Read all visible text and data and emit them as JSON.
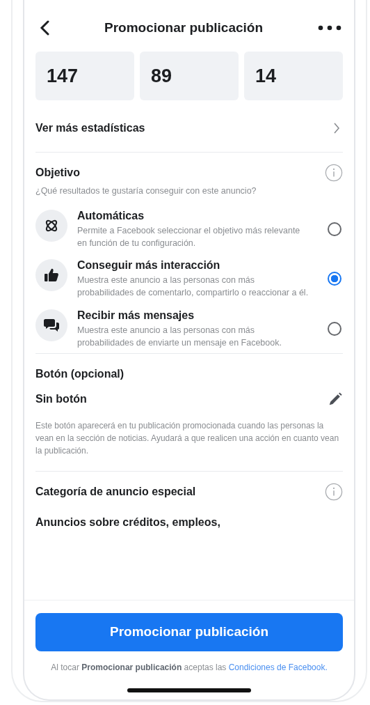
{
  "header": {
    "title": "Promocionar publicación"
  },
  "stats": [
    "147",
    "89",
    "14"
  ],
  "more_stats": {
    "label": "Ver más estadísticas"
  },
  "objective": {
    "title": "Objetivo",
    "question": "¿Qué resultados te gustaría conseguir con este anuncio?",
    "options": [
      {
        "kind": "auto",
        "title": "Automáticas",
        "description": "Permite a Facebook seleccionar el objetivo más relevante en función de tu configuración.",
        "selected": false
      },
      {
        "kind": "like",
        "title": "Conseguir más interacción",
        "description": "Muestra este anuncio a las personas con más probabilidades de comentarlo, compartirlo o reaccionar a él.",
        "selected": true
      },
      {
        "kind": "chat",
        "title": "Recibir más mensajes",
        "description": "Muestra este anuncio a las personas con más probabilidades de enviarte un mensaje en Facebook.",
        "selected": false
      }
    ]
  },
  "button_section": {
    "title": "Botón (opcional)",
    "value": "Sin botón",
    "description": "Este botón aparecerá en tu publicación promocionada cuando las personas la vean en la sección de noticias. Ayudará a que realicen una acción en cuanto vean la publicación."
  },
  "special_category": {
    "title": "Categoría de anuncio especial",
    "text": "Anuncios sobre créditos, empleos,"
  },
  "footer": {
    "button": "Promocionar publicación",
    "terms": "Al tocar **Promocionar publicación** aceptas las",
    "terms_link": "Condiciones de Facebook."
  }
}
